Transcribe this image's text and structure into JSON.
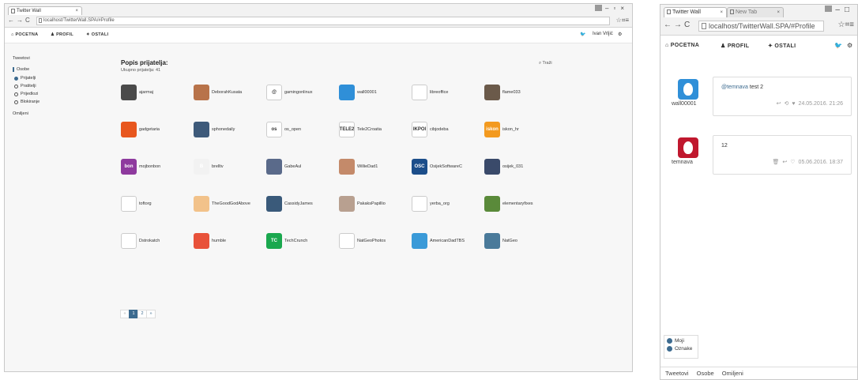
{
  "desktop": {
    "tab_title": "Twitter Wall",
    "url": "localhost/TwitterWall.SPA/#Profile",
    "nav": [
      "POCETNA",
      "PROFIL",
      "OSTALI"
    ],
    "user_name": "Ivan Vrljić",
    "sidebar": {
      "tweets": "Tweetovi",
      "osobe": "Osobe",
      "options": [
        {
          "label": "Prijatelji",
          "selected": true
        },
        {
          "label": "Pratitelji",
          "selected": false
        },
        {
          "label": "Prijedlozi",
          "selected": false
        },
        {
          "label": "Blokiranje",
          "selected": false
        }
      ],
      "omiljeni": "Omiljeni"
    },
    "title": "Popis prijatelja:",
    "subtitle": "Ukupno prijatelja: 41",
    "search_label": "Traži",
    "friends": [
      {
        "name": "ajarmaj",
        "color": "#4a4a4a",
        "glyph": ""
      },
      {
        "name": "DeborahKusata",
        "color": "#b8734a",
        "glyph": ""
      },
      {
        "name": "gamingonlinux",
        "color": "#ffffff",
        "glyph": "@"
      },
      {
        "name": "wall00001",
        "color": "#2f8fd8",
        "glyph": ""
      },
      {
        "name": "libreoffice",
        "color": "#ffffff",
        "glyph": ""
      },
      {
        "name": "flame033",
        "color": "#6b5a4a",
        "glyph": ""
      },
      {
        "name": "gadgetaria",
        "color": "#e8571e",
        "glyph": ""
      },
      {
        "name": "sphonedaily",
        "color": "#3e5a7a",
        "glyph": ""
      },
      {
        "name": "os_open",
        "color": "#ffffff",
        "glyph": "os"
      },
      {
        "name": "Tele2Croatia",
        "color": "#ffffff",
        "glyph": "TELE2"
      },
      {
        "name": "cibjodeba",
        "color": "#ffffff",
        "glyph": "IKPOI"
      },
      {
        "name": "iskon_hr",
        "color": "#f39a1f",
        "glyph": "iskon"
      },
      {
        "name": "mojbonbon",
        "color": "#8e3a9e",
        "glyph": "bon"
      },
      {
        "name": "brelltv",
        "color": "#f2f2f2",
        "glyph": "B"
      },
      {
        "name": "GabeAul",
        "color": "#5a6a8a",
        "glyph": ""
      },
      {
        "name": "WillieDad1",
        "color": "#c48a6a",
        "glyph": ""
      },
      {
        "name": "OsijekSoftwareC",
        "color": "#1c4e8a",
        "glyph": "OSC"
      },
      {
        "name": "osijek_031",
        "color": "#3a4a6a",
        "glyph": ""
      },
      {
        "name": "toftorg",
        "color": "#ffffff",
        "glyph": ""
      },
      {
        "name": "TheGoodGodAbove",
        "color": "#f2c28a",
        "glyph": ""
      },
      {
        "name": "CassidyJames",
        "color": "#3a5a7a",
        "glyph": ""
      },
      {
        "name": "PakaksPapillio",
        "color": "#b8a090",
        "glyph": ""
      },
      {
        "name": "yerba_org",
        "color": "#ffffff",
        "glyph": ""
      },
      {
        "name": "elementaryfixes",
        "color": "#5a8a3a",
        "glyph": ""
      },
      {
        "name": "Dstrokatch",
        "color": "#ffffff",
        "glyph": ""
      },
      {
        "name": "humble",
        "color": "#e8523a",
        "glyph": ""
      },
      {
        "name": "TechCrunch",
        "color": "#1aa84e",
        "glyph": "TC"
      },
      {
        "name": "NatGeoPhotos",
        "color": "#ffffff",
        "glyph": ""
      },
      {
        "name": "AmericanDadTBS",
        "color": "#3a9ad8",
        "glyph": ""
      },
      {
        "name": "NatGeo",
        "color": "#4a7a9a",
        "glyph": ""
      }
    ],
    "pagination": [
      "«",
      "1",
      "2",
      "»"
    ]
  },
  "mobile": {
    "tab_title": "Twitter Wall",
    "tab2_title": "New Tab",
    "url": "localhost/TwitterWall.SPA/#Profile",
    "nav": [
      "POCETNA",
      "PROFIL",
      "OSTALI"
    ],
    "tweets": [
      {
        "user": "wall00001",
        "color": "#2f8fd8",
        "mention": "@temnava",
        "text": " test 2",
        "date": "24.05.2016. 21:26"
      },
      {
        "user": "temnava",
        "color": "#c0182e",
        "mention": "",
        "text": "12",
        "date": "05.06.2016. 18:37"
      }
    ],
    "filters": [
      "Moji",
      "Oznake"
    ],
    "bottom_tabs": [
      "Tweetovi",
      "Osobe",
      "Omiljeni"
    ]
  }
}
